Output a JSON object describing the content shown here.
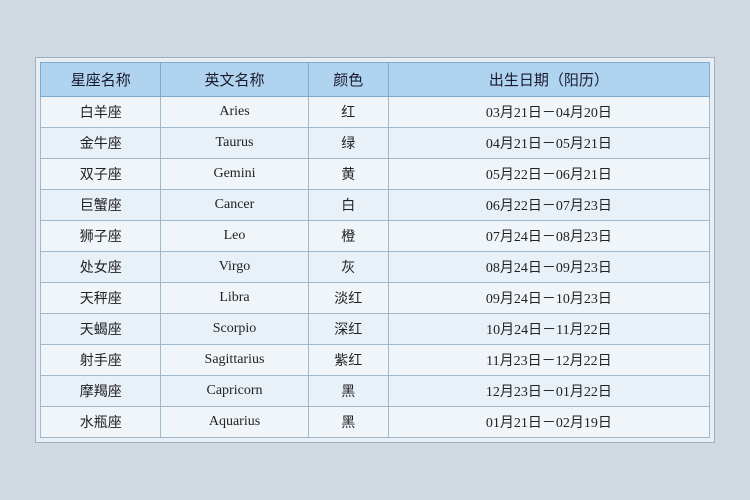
{
  "table": {
    "headers": [
      "星座名称",
      "英文名称",
      "颜色",
      "出生日期（阳历）"
    ],
    "rows": [
      {
        "cn": "白羊座",
        "en": "Aries",
        "color": "红",
        "date": "03月21日－04月20日"
      },
      {
        "cn": "金牛座",
        "en": "Taurus",
        "color": "绿",
        "date": "04月21日－05月21日"
      },
      {
        "cn": "双子座",
        "en": "Gemini",
        "color": "黄",
        "date": "05月22日－06月21日"
      },
      {
        "cn": "巨蟹座",
        "en": "Cancer",
        "color": "白",
        "date": "06月22日－07月23日"
      },
      {
        "cn": "狮子座",
        "en": "Leo",
        "color": "橙",
        "date": "07月24日－08月23日"
      },
      {
        "cn": "处女座",
        "en": "Virgo",
        "color": "灰",
        "date": "08月24日－09月23日"
      },
      {
        "cn": "天秤座",
        "en": "Libra",
        "color": "淡红",
        "date": "09月24日－10月23日"
      },
      {
        "cn": "天蝎座",
        "en": "Scorpio",
        "color": "深红",
        "date": "10月24日－11月22日"
      },
      {
        "cn": "射手座",
        "en": "Sagittarius",
        "color": "紫红",
        "date": "11月23日－12月22日"
      },
      {
        "cn": "摩羯座",
        "en": "Capricorn",
        "color": "黑",
        "date": "12月23日－01月22日"
      },
      {
        "cn": "水瓶座",
        "en": "Aquarius",
        "color": "黑",
        "date": "01月21日－02月19日"
      }
    ]
  }
}
